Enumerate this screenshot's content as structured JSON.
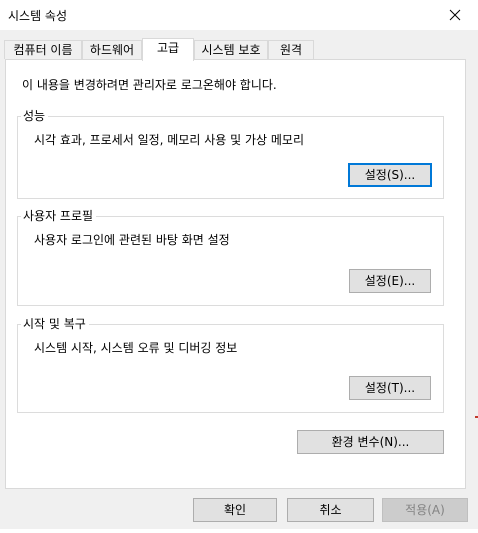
{
  "window": {
    "title": "시스템 속성"
  },
  "tabs": [
    {
      "label": "컴퓨터 이름",
      "active": false
    },
    {
      "label": "하드웨어",
      "active": false
    },
    {
      "label": "고급",
      "active": true
    },
    {
      "label": "시스템 보호",
      "active": false
    },
    {
      "label": "원격",
      "active": false
    }
  ],
  "advanced": {
    "admin_notice": "이 내용을 변경하려면 관리자로 로그온해야 합니다.",
    "performance": {
      "label": "성능",
      "description": "시각 효과, 프로세서 일정, 메모리 사용 및 가상 메모리",
      "button": "설정(S)..."
    },
    "user_profiles": {
      "label": "사용자 프로필",
      "description": "사용자 로그인에 관련된 바탕 화면 설정",
      "button": "설정(E)..."
    },
    "startup_recovery": {
      "label": "시작 및 복구",
      "description": "시스템 시작, 시스템 오류 및 디버깅 정보",
      "button": "설정(T)..."
    },
    "env_button": "환경 변수(N)..."
  },
  "footer": {
    "ok": "확인",
    "cancel": "취소",
    "apply": "적용(A)"
  },
  "icons": {
    "close": "close-icon"
  },
  "colors": {
    "focus_border": "#0078d7",
    "button_bg": "#e1e1e1",
    "disabled_bg": "#cccccc",
    "disabled_text": "#838383"
  }
}
